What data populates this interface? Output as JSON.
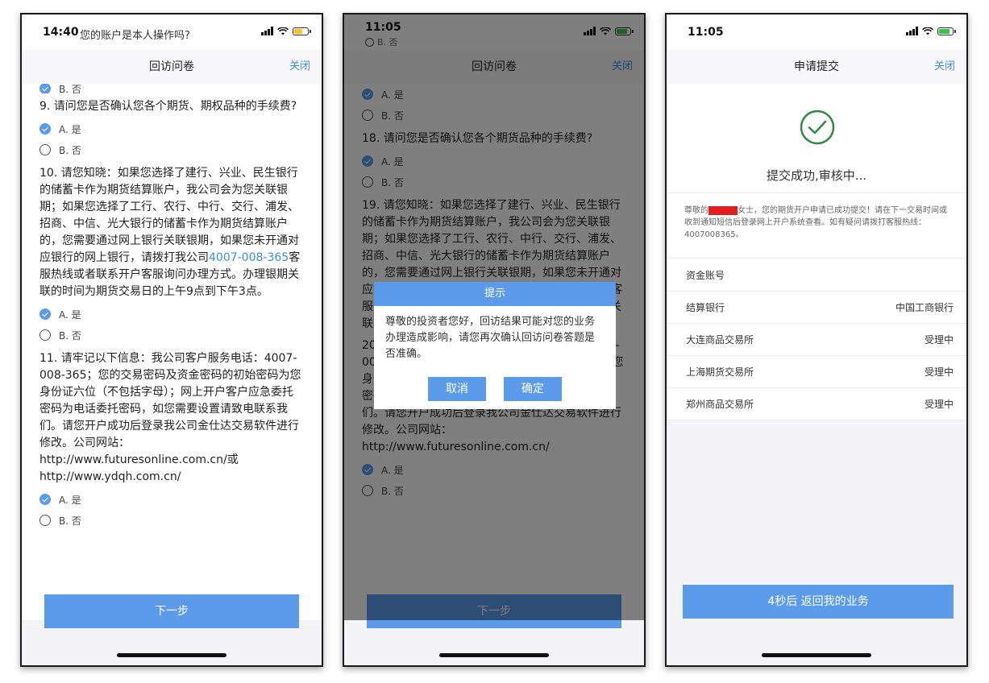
{
  "colors": {
    "accent": "#5b9bea",
    "link": "#3a8ee6",
    "redaction": "#e21e1e"
  },
  "screen1": {
    "status": {
      "time": "14:40",
      "notification": "您的账户是本人操作吗?"
    },
    "nav": {
      "title": "回访问卷",
      "close": "关闭"
    },
    "partial_option": "B. 否",
    "q9": {
      "text": "9. 请问您是否确认您各个期货、期权品种的手续费?",
      "options": [
        "A. 是",
        "B. 否"
      ]
    },
    "q10": {
      "text_before": "10. 请您知晓：如果您选择了建行、兴业、民生银行的储蓄卡作为期货结算账户，我公司会为您关联银期；如果您选择了工行、农行、中行、交行、浦发、招商、中信、光大银行的储蓄卡作为期货结算账户的，您需要通过网上银行关联银期，如果您未开通对应银行的网上银行，请拨打我公司",
      "phone_link": "4007-008-365",
      "text_after": "客服热线或者联系开户客服询问办理方式。办理银期关联的时间为期货交易日的上午9点到下午3点。",
      "options": [
        "A. 是",
        "B. 否"
      ]
    },
    "q11": {
      "text": "11. 请牢记以下信息：我公司客户服务电话：4007-008-365；您的交易密码及资金密码的初始密码为您身份证六位（不包括字母）；网上开户客户应急委托密码为电话委托密码，如您需要设置请致电联系我们。请您开户成功后登录我公司金仕达交易软件进行修改。公司网站：",
      "url1": "http://www.futuresonline.com.cn/或",
      "url2": "http://www.ydqh.com.cn/",
      "options": [
        "A. 是",
        "B. 否"
      ]
    },
    "next_button": "下一步"
  },
  "screen2": {
    "status": {
      "time": "11:05",
      "sub": "B. 否"
    },
    "nav": {
      "title": "回访问卷",
      "close": "关闭"
    },
    "top_options": [
      "A. 是",
      "B. 否"
    ],
    "q18": {
      "text": "18. 请问您是否确认您各个期货品种的手续费?",
      "options": [
        "A. 是",
        "B. 否"
      ]
    },
    "q19": {
      "text": "19. 请您知晓：如果您选择了建行、兴业、民生银行的储蓄卡作为期货结算账户，我公司会为您关联银期；如果您选择了工行、农行、中行、交行、浦发、招商、中信、光大银行的储蓄卡作为期货结算账户的，您需要通过网上银行关联银期，如果您未开通对应银行的网上银行，请拨打我公司4007-008-365客服热线或者联系开户客服询问办理方式。办理银期关联的时间为期货交易日的上午9点到下午3点。"
    },
    "q20": {
      "text": "20. 请牢记以下信息：我公司客户服务电话：4007-008-365；您的交易密码及资金密码的初始密码为您身份证六位（不包括字母）；网上开户客户应急委托密码为电话委托密码，如您需要设置请致电联系我们。请您开户成功后登录我公司金仕达交易软件进行修改。公司网站：",
      "url": "http://www.futuresonline.com.cn/",
      "options": [
        "A. 是",
        "B. 否"
      ]
    },
    "next_button": "下一步",
    "dialog": {
      "title": "提示",
      "message": "尊敬的投资者您好，回访结果可能对您的业务办理造成影响，请您再次确认回访问卷答题是否准确。",
      "cancel": "取消",
      "confirm": "确定"
    }
  },
  "screen3": {
    "status": {
      "time": "11:05"
    },
    "nav": {
      "title": "申请提交",
      "close": "关闭"
    },
    "success_text": "提交成功,审核中...",
    "notice_prefix": "尊敬的",
    "notice_body": "女士，您的期货开户申请已成功提交！请在下一交易时间或收到通知短信后登录网上开户系统查看。如有疑问请拨打客服热线：4007008365。",
    "rows": [
      {
        "label": "资金账号",
        "value": ""
      },
      {
        "label": "结算银行",
        "value": "中国工商银行"
      },
      {
        "label": "大连商品交易所",
        "value": "受理中"
      },
      {
        "label": "上海期货交易所",
        "value": "受理中"
      },
      {
        "label": "郑州商品交易所",
        "value": "受理中"
      }
    ],
    "return_button": "4秒后 返回我的业务"
  }
}
